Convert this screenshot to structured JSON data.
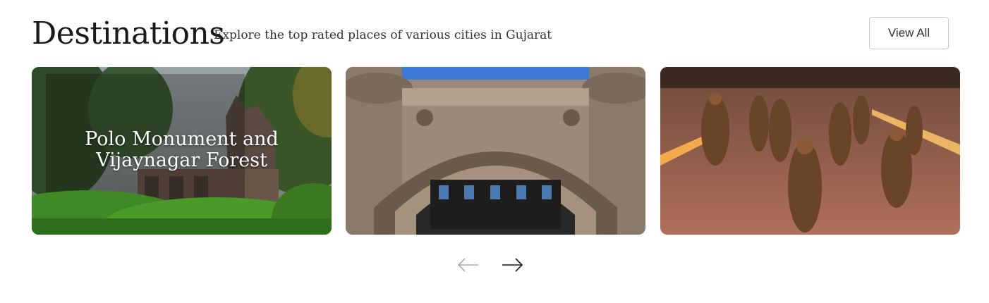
{
  "header": {
    "title": "Destinations",
    "subtitle": "Explore the top rated places of various cities in Gujarat",
    "view_all_label": "View All"
  },
  "cards": [
    {
      "caption_line1": "Polo Monument and",
      "caption_line2": "Vijaynagar Forest",
      "image": "forest-temple-photo"
    },
    {
      "caption_line1": "",
      "caption_line2": "",
      "image": "stone-arch-gate-photo"
    },
    {
      "caption_line1": "",
      "caption_line2": "",
      "image": "bronze-statues-march-photo"
    }
  ],
  "nav": {
    "prev_icon": "arrow-left-icon",
    "next_icon": "arrow-right-icon",
    "prev_color": "#9a9a9a",
    "next_color": "#1a1a1a"
  }
}
